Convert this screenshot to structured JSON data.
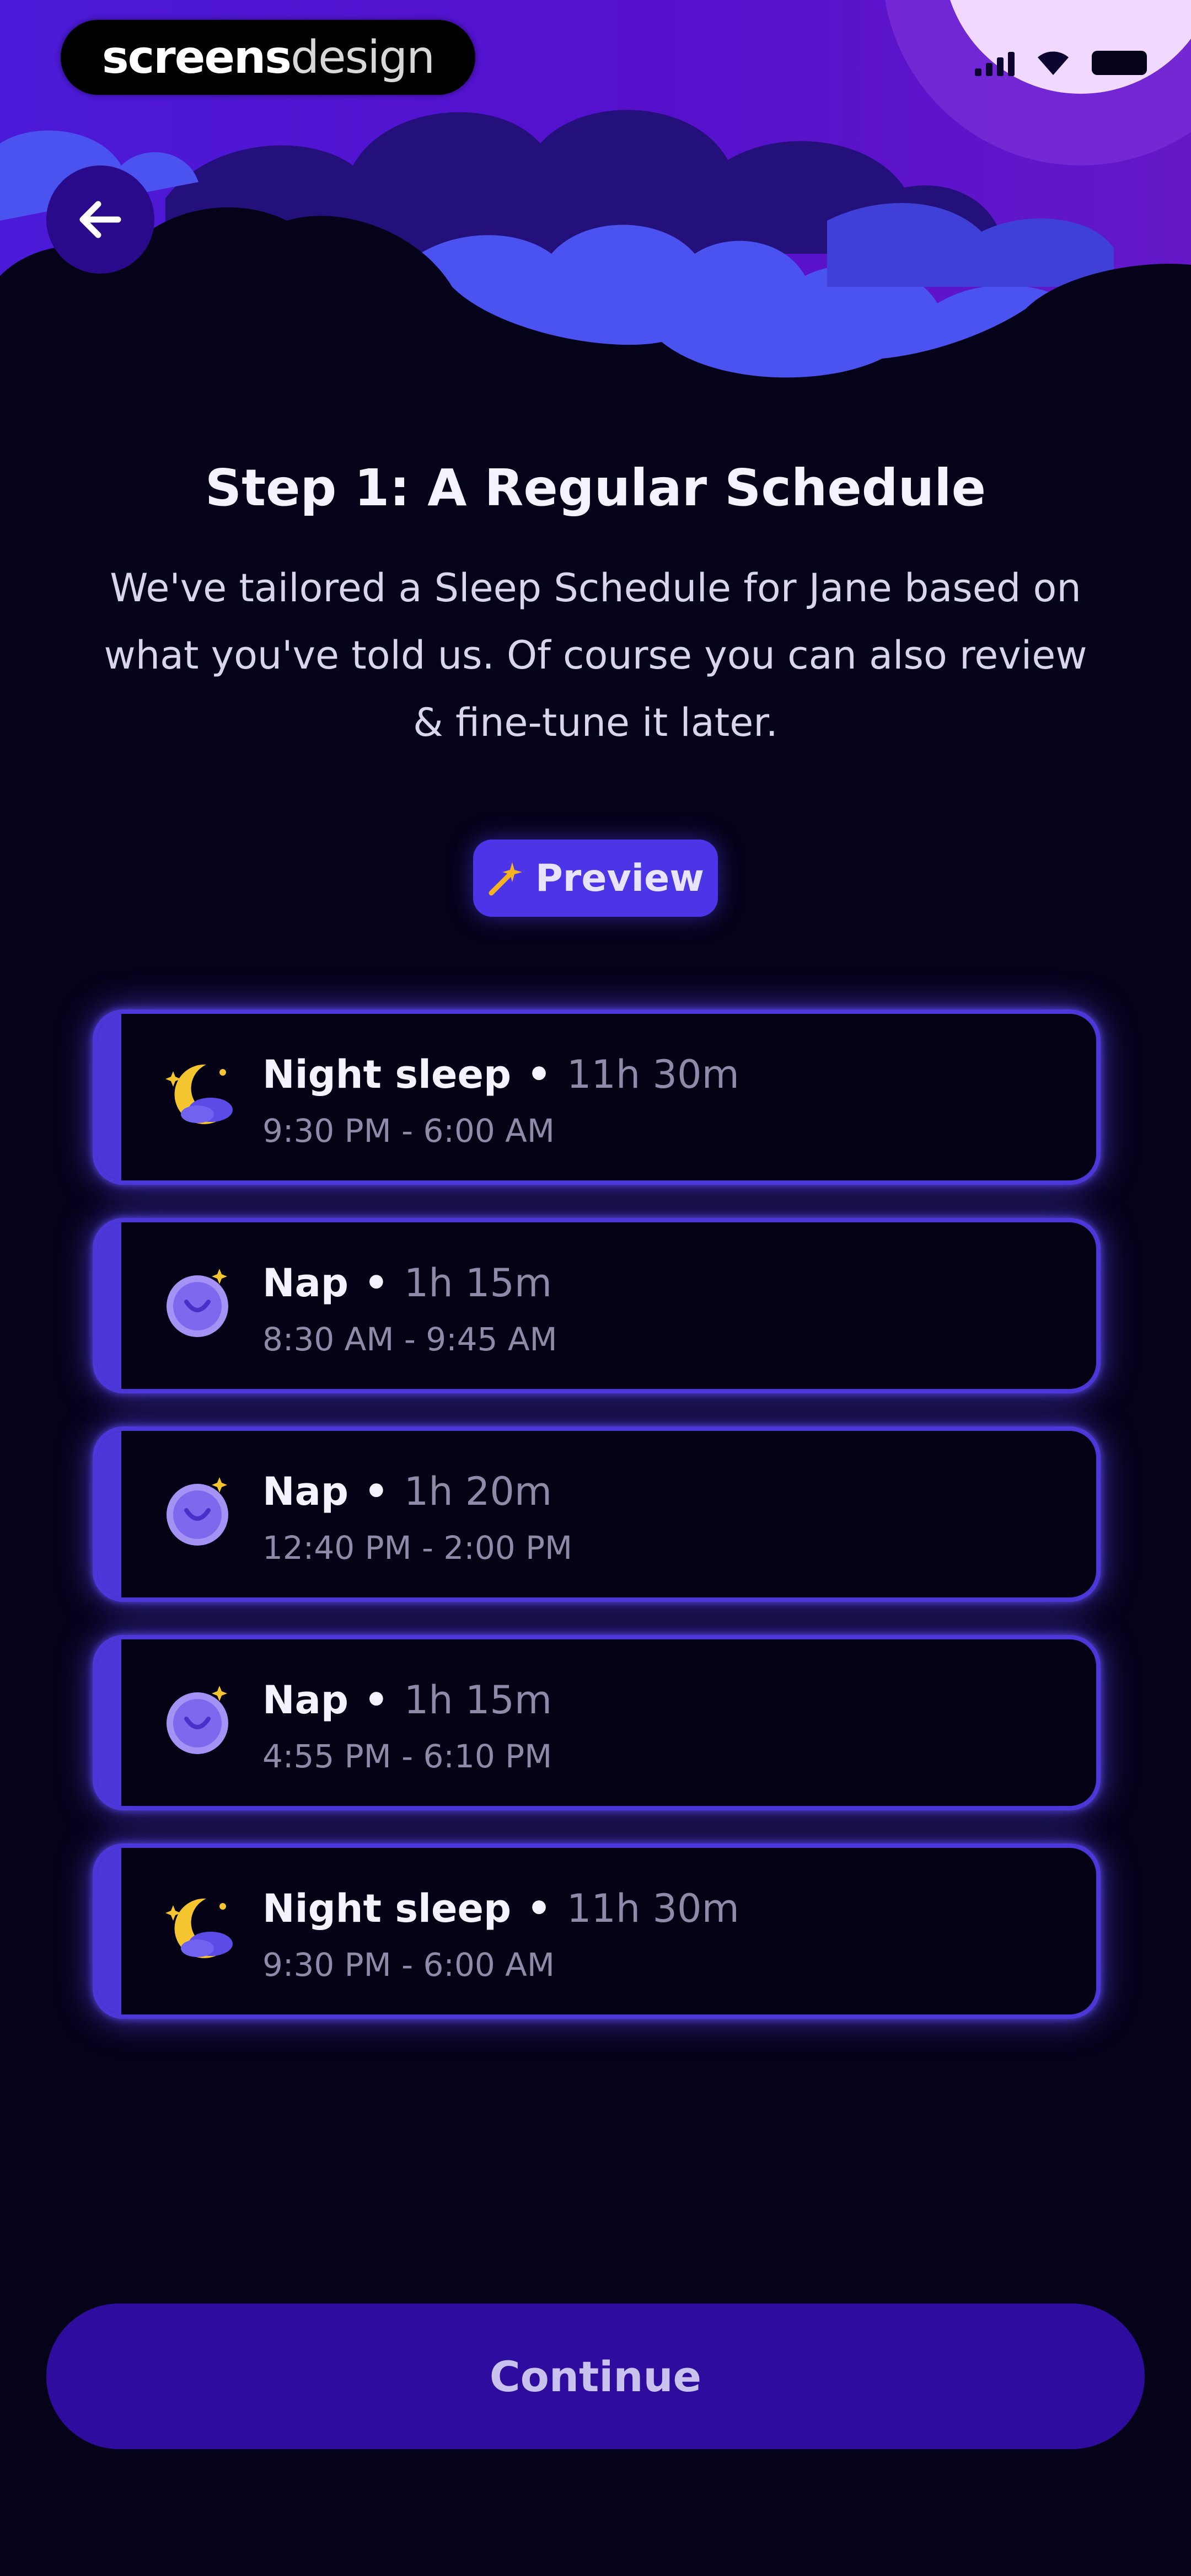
{
  "watermark": {
    "bold_part": "screens",
    "light_part": "design"
  },
  "header": {
    "back_icon": "arrow-left-icon"
  },
  "content": {
    "title": "Step 1: A Regular Schedule",
    "subtitle": "We've tailored a Sleep Schedule for Jane based on what you've told us. Of course you can also review & fine-tune it later.",
    "preview_label": "Preview",
    "preview_icon": "sparkle-icon"
  },
  "schedule": {
    "items": [
      {
        "kind": "Night sleep",
        "duration": "11h 30m",
        "range": "9:30 PM - 6:00 AM",
        "icon": "moon-stars-icon"
      },
      {
        "kind": "Nap",
        "duration": "1h 15m",
        "range": "8:30 AM - 9:45 AM",
        "icon": "nap-clock-icon"
      },
      {
        "kind": "Nap",
        "duration": "1h 20m",
        "range": "12:40 PM - 2:00 PM",
        "icon": "nap-clock-icon"
      },
      {
        "kind": "Nap",
        "duration": "1h 15m",
        "range": "4:55 PM - 6:10 PM",
        "icon": "nap-clock-icon"
      },
      {
        "kind": "Night sleep",
        "duration": "11h 30m",
        "range": "9:30 PM - 6:00 AM",
        "icon": "moon-stars-icon"
      }
    ]
  },
  "footer": {
    "continue_label": "Continue"
  },
  "colors": {
    "background": "#05031A",
    "accent": "#4C38D8",
    "button": "#2E0C9E",
    "sky": "#5A10D0"
  }
}
